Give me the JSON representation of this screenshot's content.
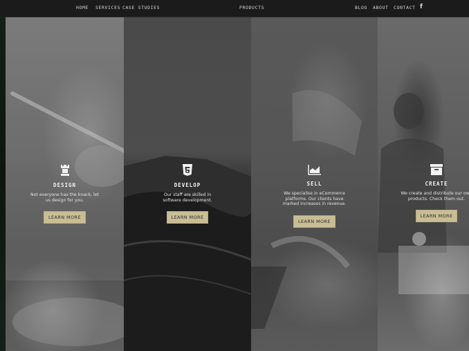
{
  "nav": {
    "left": [
      "HOME",
      "SERVICES",
      "CASE STUDIES"
    ],
    "center": "PRODUCTS",
    "right": [
      "BLOG",
      "ABOUT",
      "CONTACT"
    ],
    "social": "f"
  },
  "panels": [
    {
      "title": "DESIGN",
      "desc": "Not everyone has the knack, let us design for you.",
      "button": "LEARN MORE",
      "icon": "chess-rook-icon"
    },
    {
      "title": "DEVELOP",
      "desc": "Our staff are skilled in software development.",
      "button": "LEARN MORE",
      "icon": "html5-icon"
    },
    {
      "title": "SELL",
      "desc": "We specialise in eCommerce platforms. Our clients have marked increases in revenue.",
      "button": "LEARN MORE",
      "icon": "area-chart-icon"
    },
    {
      "title": "CREATE",
      "desc": "We create and distribute our own products. Check them out.",
      "button": "LEARN MORE",
      "icon": "archive-box-icon"
    }
  ],
  "colors": {
    "button": "#c9bd95",
    "nav": "#1b1b1b"
  }
}
